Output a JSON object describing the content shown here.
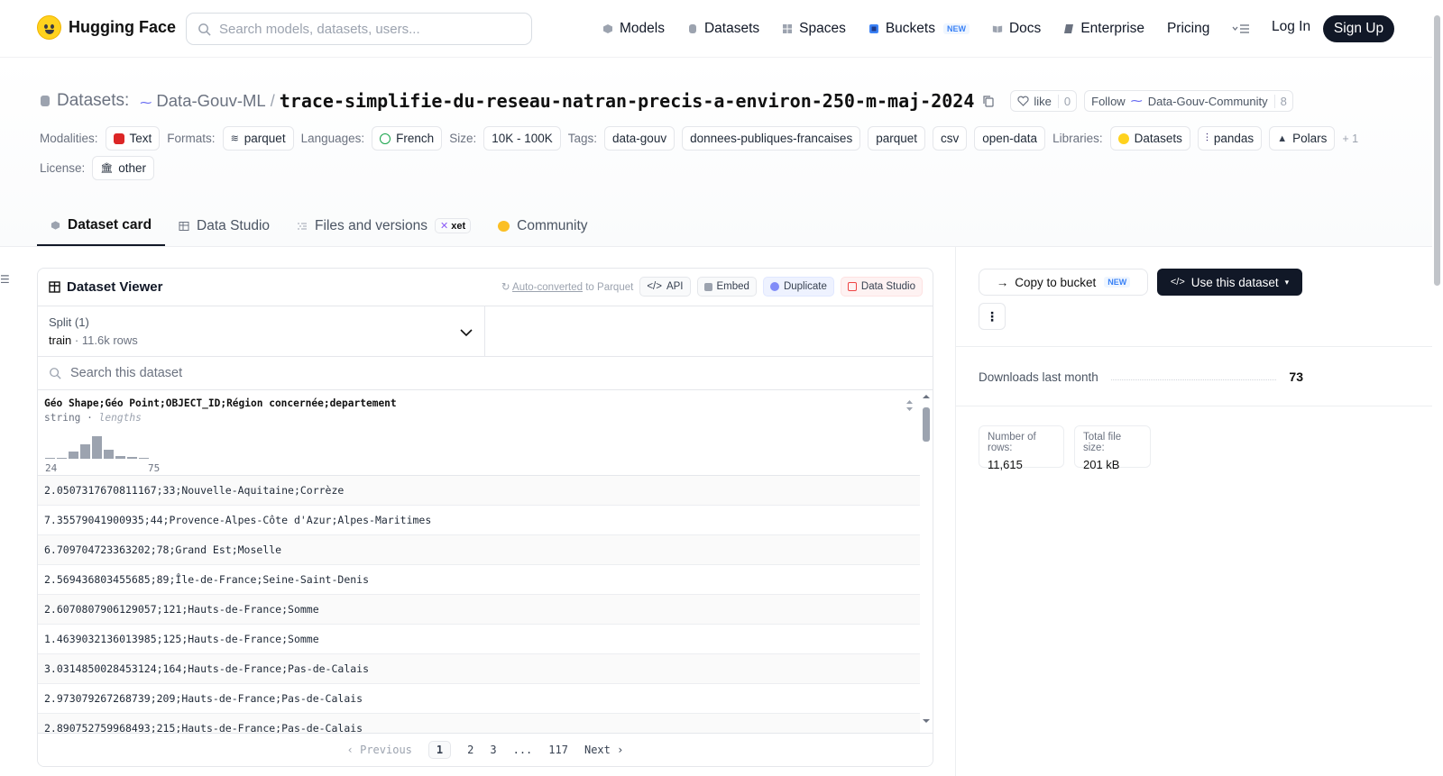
{
  "nav": {
    "brand": "Hugging Face",
    "search_placeholder": "Search models, datasets, users...",
    "links": [
      {
        "label": "Models",
        "icon": "cube-icon"
      },
      {
        "label": "Datasets",
        "icon": "database-icon"
      },
      {
        "label": "Spaces",
        "icon": "grid-icon"
      },
      {
        "label": "Buckets",
        "icon": "bucket-icon",
        "badge": "NEW"
      },
      {
        "label": "Docs",
        "icon": "book-icon"
      },
      {
        "label": "Enterprise",
        "icon": "enterprise-icon"
      },
      {
        "label": "Pricing"
      }
    ],
    "login": "Log In",
    "signup": "Sign Up"
  },
  "header": {
    "crumb_label": "Datasets:",
    "org": "Data-Gouv-ML",
    "sep": "/",
    "name": "trace-simplifie-du-reseau-natran-precis-a-environ-250-m-maj-2024",
    "like_label": "like",
    "like_count": "0",
    "follow_label": "Follow",
    "follow_org": "Data-Gouv-Community",
    "follow_count": "8"
  },
  "tags": {
    "modalities_label": "Modalities:",
    "modality": "Text",
    "formats_label": "Formats:",
    "format": "parquet",
    "languages_label": "Languages:",
    "language": "French",
    "size_label": "Size:",
    "size": "10K - 100K",
    "tags_label": "Tags:",
    "tag_list": [
      "data-gouv",
      "donnees-publiques-francaises",
      "parquet",
      "csv",
      "open-data"
    ],
    "libraries_label": "Libraries:",
    "libraries": [
      "Datasets",
      "pandas",
      "Polars"
    ],
    "libraries_more": "+ 1",
    "license_label": "License:",
    "license": "other"
  },
  "tabs": [
    {
      "label": "Dataset card"
    },
    {
      "label": "Data Studio"
    },
    {
      "label": "Files and versions",
      "badge": "xet"
    },
    {
      "label": "Community"
    }
  ],
  "viewer": {
    "title": "Dataset Viewer",
    "auto_link": "Auto-converted",
    "auto_rest": " to Parquet",
    "api": "API",
    "embed": "Embed",
    "duplicate": "Duplicate",
    "data_studio": "Data Studio",
    "split_label": "Split (1)",
    "split_name": "train",
    "split_dot": "·",
    "split_rows": "11.6k rows",
    "search_placeholder": "Search this dataset",
    "column_name": "Géo Shape;Géo Point;OBJECT_ID;Région concernée;departement",
    "column_type": "string",
    "column_type_dot": "·",
    "column_type_extra": "lengths",
    "hist_values": [
      0.05,
      0.05,
      0.3,
      0.65,
      1.0,
      0.4,
      0.1,
      0.08,
      0.05
    ],
    "hist_min": "24",
    "hist_max": "75",
    "rows": [
      "2.0507317670811167;33;Nouvelle-Aquitaine;Corrèze",
      "7.35579041900935;44;Provence-Alpes-Côte d'Azur;Alpes-Maritimes",
      "6.709704723363202;78;Grand Est;Moselle",
      "2.569436803455685;89;Île-de-France;Seine-Saint-Denis",
      "2.6070807906129057;121;Hauts-de-France;Somme",
      "1.4639032136013985;125;Hauts-de-France;Somme",
      "3.0314850028453124;164;Hauts-de-France;Pas-de-Calais",
      "2.973079267268739;209;Hauts-de-France;Pas-de-Calais",
      "2.890752759968493;215;Hauts-de-France;Pas-de-Calais"
    ],
    "pager": {
      "prev": "Previous",
      "pages": [
        "1",
        "2",
        "3"
      ],
      "ellipsis": "...",
      "last": "117",
      "next": "Next"
    }
  },
  "side": {
    "copy_bucket": "Copy to bucket",
    "copy_badge": "NEW",
    "use_dataset": "Use this dataset",
    "downloads_label": "Downloads last month",
    "downloads": "73",
    "rows_label": "Number of rows:",
    "rows_value": "11,615",
    "size_label": "Total file size:",
    "size_value": "201 kB"
  },
  "colors": {
    "accent": "#111827",
    "hf_yellow": "#ffd21e",
    "border": "#e5e7eb"
  }
}
